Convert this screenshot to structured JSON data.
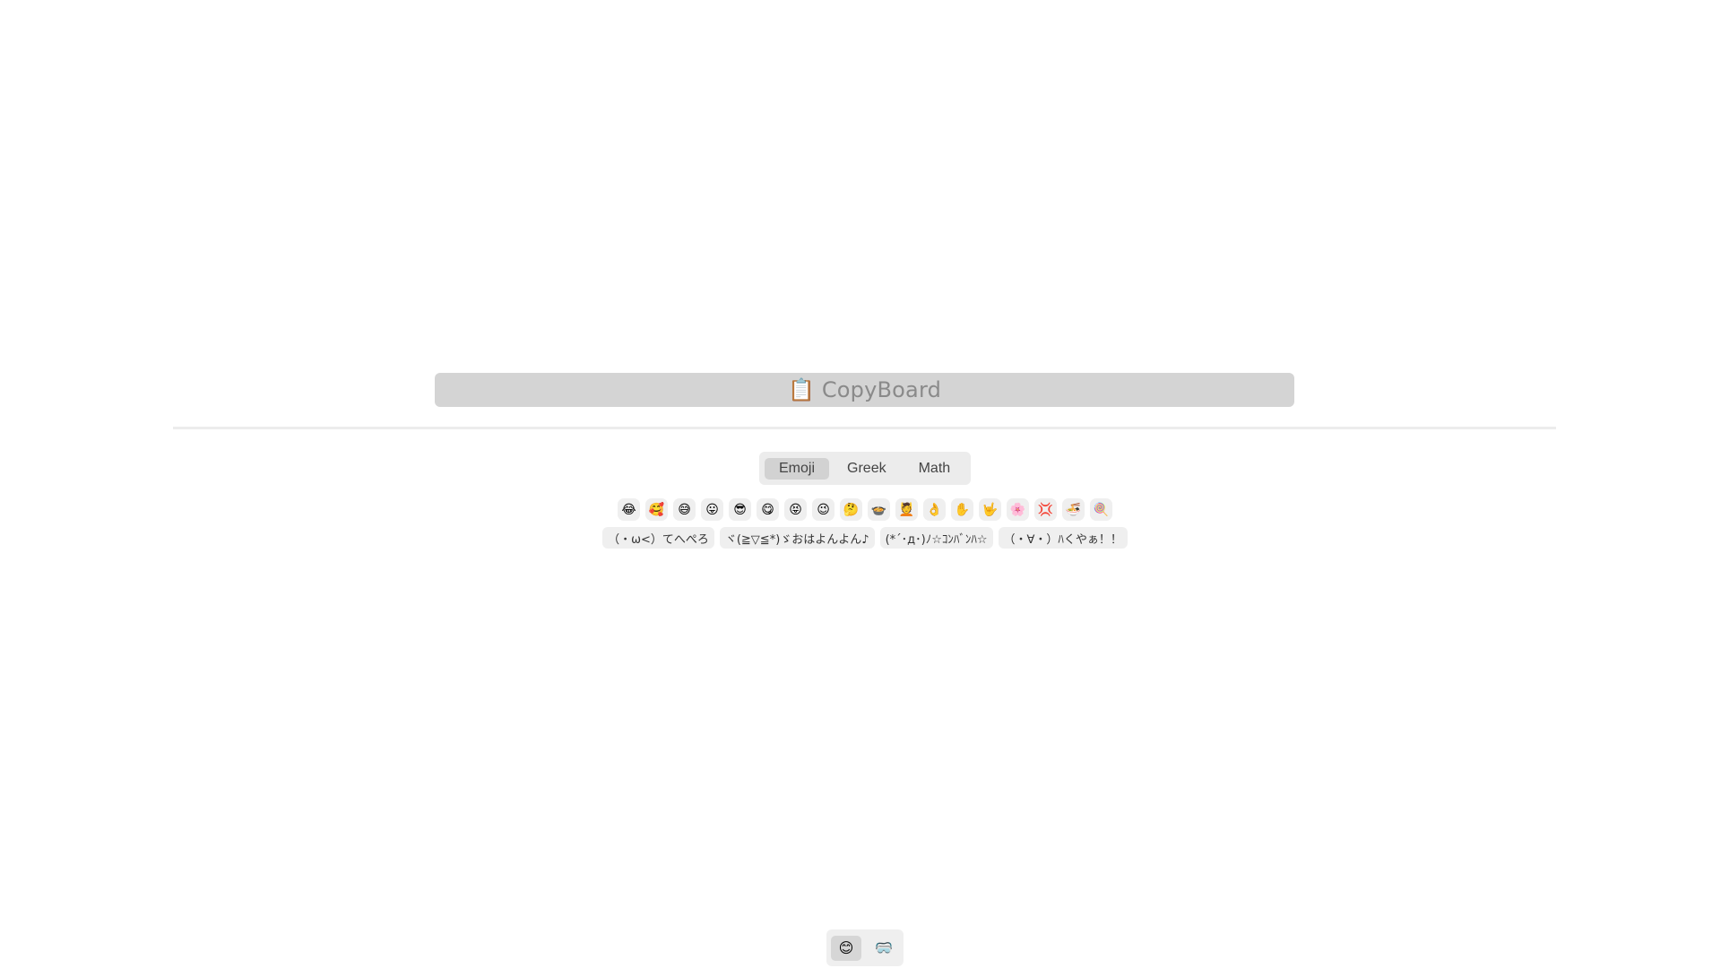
{
  "app": {
    "title": "CopyBoard",
    "title_icon": "📋"
  },
  "tabs": [
    {
      "label": "Emoji",
      "active": true
    },
    {
      "label": "Greek",
      "active": false
    },
    {
      "label": "Math",
      "active": false
    }
  ],
  "emoji": [
    "😂",
    "🥰",
    "😅",
    "😛",
    "😎",
    "😋",
    "😝",
    "😉",
    "🤔",
    "🍲",
    "💆",
    "👌",
    "✋",
    "🤟",
    "🌸",
    "💢",
    "🍜",
    "🍭"
  ],
  "kaomoji": [
    "（・ω<）てへぺろ",
    "ヾ(≧▽≦*)ゞおはよんよん♪",
    "(*´･д･)ﾉ☆ｺﾝﾊﾞﾝﾊ☆",
    "（・∀・）ﾊくやぁ！！"
  ],
  "bottom": [
    {
      "icon": "😊",
      "active": true
    },
    {
      "icon": "🥽",
      "active": false
    }
  ]
}
